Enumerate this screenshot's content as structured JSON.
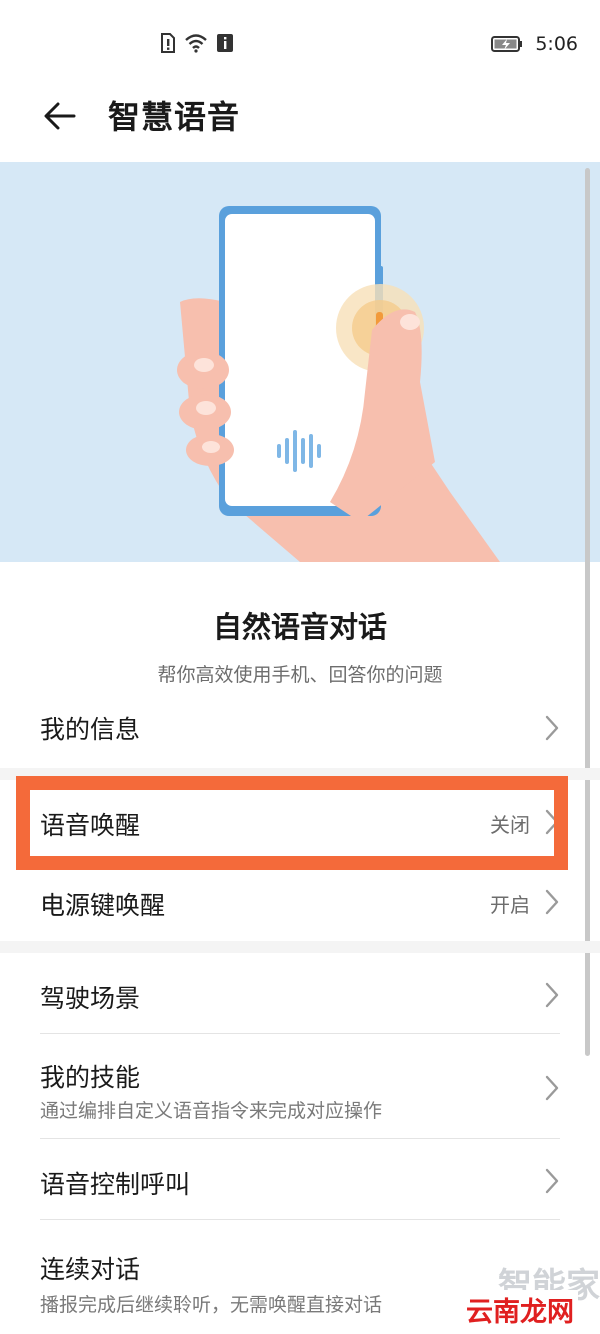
{
  "status_bar": {
    "time": "5:06"
  },
  "header": {
    "title": "智慧语音"
  },
  "intro": {
    "title": "自然语音对话",
    "subtitle": "帮你高效使用手机、回答你的问题"
  },
  "settings": {
    "my_info": {
      "label": "我的信息"
    },
    "voice_wakeup": {
      "label": "语音唤醒",
      "value": "关闭"
    },
    "power_key_wakeup": {
      "label": "电源键唤醒",
      "value": "开启"
    },
    "driving_scene": {
      "label": "驾驶场景"
    },
    "my_skills": {
      "label": "我的技能",
      "description": "通过编排自定义语音指令来完成对应操作"
    },
    "voice_call": {
      "label": "语音控制呼叫"
    },
    "continuous_dialogue": {
      "label": "连续对话",
      "description": "播报完成后继续聆听，无需唤醒直接对话"
    }
  },
  "watermarks": {
    "site_a": "智能家",
    "site_b": "云南龙网"
  },
  "colors": {
    "highlight_border": "#f46a3a",
    "hero_background": "#d6e8f6",
    "phone_frame": "#5aa0dc",
    "skin": "#f7bfae"
  }
}
